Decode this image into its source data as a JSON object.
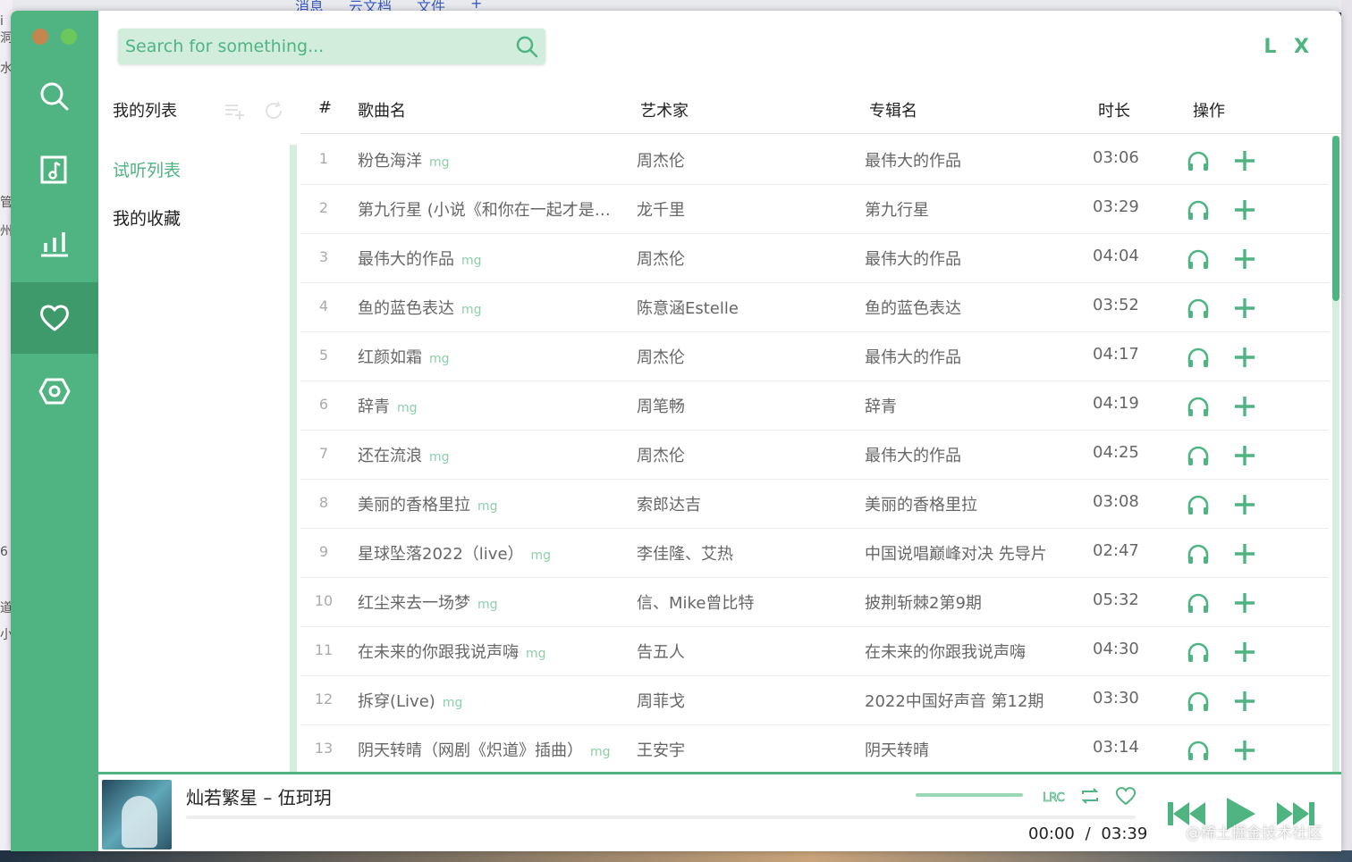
{
  "desktop": {
    "tabs": [
      "消息",
      "云文档",
      "文件",
      "+"
    ],
    "left_edge_text": [
      "i洞",
      "水",
      "管",
      "州",
      "6",
      "道",
      "小"
    ]
  },
  "app": {
    "brand": "L X",
    "search": {
      "placeholder": "Search for something..."
    },
    "nav": [
      "search-icon",
      "music-file-icon",
      "bar-chart-icon",
      "heart-icon",
      "settings-icon"
    ]
  },
  "lists": {
    "header": "我的列表",
    "items": [
      {
        "label": "试听列表",
        "active": true
      },
      {
        "label": "我的收藏",
        "active": false
      }
    ]
  },
  "table": {
    "headers": {
      "index": "#",
      "title": "歌曲名",
      "artist": "艺术家",
      "album": "专辑名",
      "duration": "时长",
      "actions": "操作"
    },
    "rows": [
      {
        "index": "1",
        "title": "粉色海洋",
        "tag": "mg",
        "artist": "周杰伦",
        "album": "最伟大的作品",
        "duration": "03:06"
      },
      {
        "index": "2",
        "title": "第九行星 (小说《和你在一起才是…",
        "tag": "",
        "artist": "龙千里",
        "album": "第九行星",
        "duration": "03:29"
      },
      {
        "index": "3",
        "title": "最伟大的作品",
        "tag": "mg",
        "artist": "周杰伦",
        "album": "最伟大的作品",
        "duration": "04:04"
      },
      {
        "index": "4",
        "title": "鱼的蓝色表达",
        "tag": "mg",
        "artist": "陈意涵Estelle",
        "album": "鱼的蓝色表达",
        "duration": "03:52"
      },
      {
        "index": "5",
        "title": "红颜如霜",
        "tag": "mg",
        "artist": "周杰伦",
        "album": "最伟大的作品",
        "duration": "04:17"
      },
      {
        "index": "6",
        "title": "辞青",
        "tag": "mg",
        "artist": "周笔畅",
        "album": "辞青",
        "duration": "04:19"
      },
      {
        "index": "7",
        "title": "还在流浪",
        "tag": "mg",
        "artist": "周杰伦",
        "album": "最伟大的作品",
        "duration": "04:25"
      },
      {
        "index": "8",
        "title": "美丽的香格里拉",
        "tag": "mg",
        "artist": "索郎达吉",
        "album": "美丽的香格里拉",
        "duration": "03:08"
      },
      {
        "index": "9",
        "title": "星球坠落2022（live）",
        "tag": "mg",
        "artist": "李佳隆、艾热",
        "album": "中国说唱巅峰对决 先导片",
        "duration": "02:47"
      },
      {
        "index": "10",
        "title": "红尘来去一场梦",
        "tag": "mg",
        "artist": "信、Mike曾比特",
        "album": "披荆斩棘2第9期",
        "duration": "05:32"
      },
      {
        "index": "11",
        "title": "在未来的你跟我说声嗨",
        "tag": "mg",
        "artist": "告五人",
        "album": "在未来的你跟我说声嗨",
        "duration": "04:30"
      },
      {
        "index": "12",
        "title": "拆穿(Live)",
        "tag": "mg",
        "artist": "周菲戈",
        "album": "2022中国好声音 第12期",
        "duration": "03:30"
      },
      {
        "index": "13",
        "title": "阴天转晴（网剧《炽道》插曲）",
        "tag": "mg",
        "artist": "王安宇",
        "album": "阴天转晴",
        "duration": "03:14"
      }
    ]
  },
  "player": {
    "song": "灿若繁星 – 伍珂玥",
    "current_time": "00:00",
    "separator": "/",
    "total_time": "03:39",
    "lyric_button": "LRC",
    "progress": 0
  },
  "watermark": "@稀土掘金技术社区",
  "colors": {
    "accent": "#4fb482",
    "accent_dark": "#3e9a6b",
    "accent_light": "#d2eddc"
  }
}
